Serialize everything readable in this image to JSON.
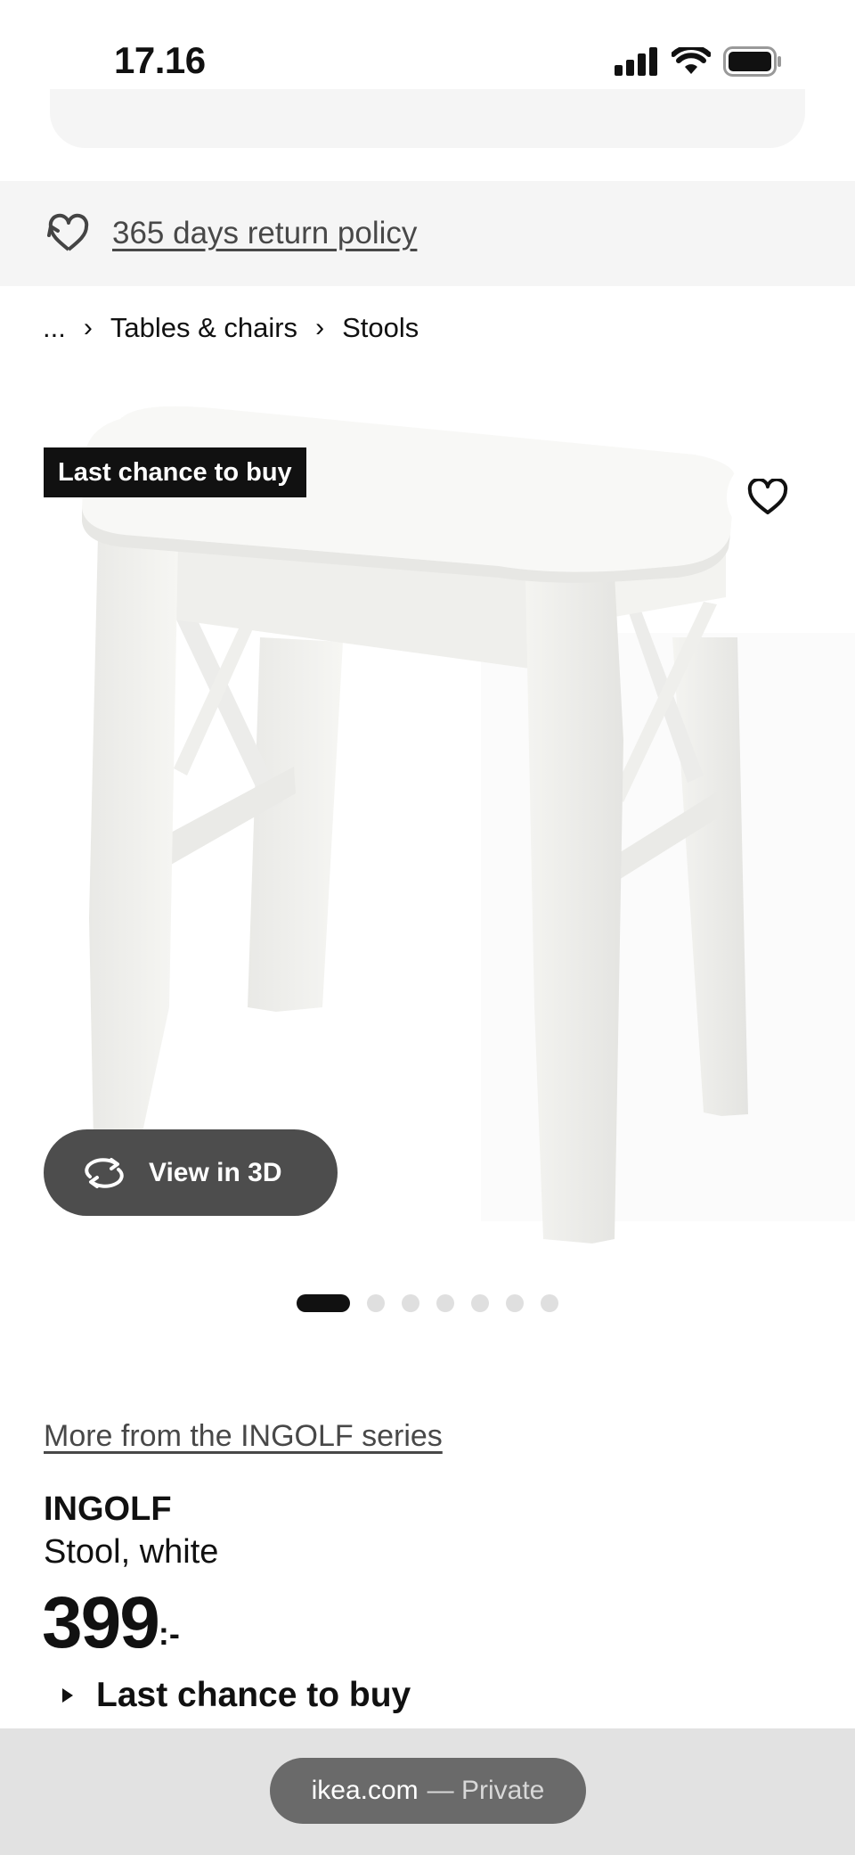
{
  "status": {
    "time": "17.16"
  },
  "banner": {
    "return_policy": "365 days return policy"
  },
  "breadcrumb": {
    "ellipsis": "...",
    "items": [
      "Tables & chairs",
      "Stools"
    ]
  },
  "gallery": {
    "badge": "Last chance to buy",
    "view3d_label": "View in 3D",
    "total_images": 7,
    "active_image": 1
  },
  "product": {
    "series_link": "More from the INGOLF series",
    "name": "INGOLF",
    "description": "Stool, white",
    "price": "399",
    "price_suffix": ":-",
    "availability": "Last chance to buy"
  },
  "browser": {
    "domain": "ikea.com",
    "mode": "— Private"
  },
  "icons": {
    "status": [
      "signal-icon",
      "wifi-icon",
      "battery-icon"
    ],
    "banner": "heart-return-icon",
    "favourite": "heart-icon",
    "view3d": "rotate-3d-icon"
  }
}
